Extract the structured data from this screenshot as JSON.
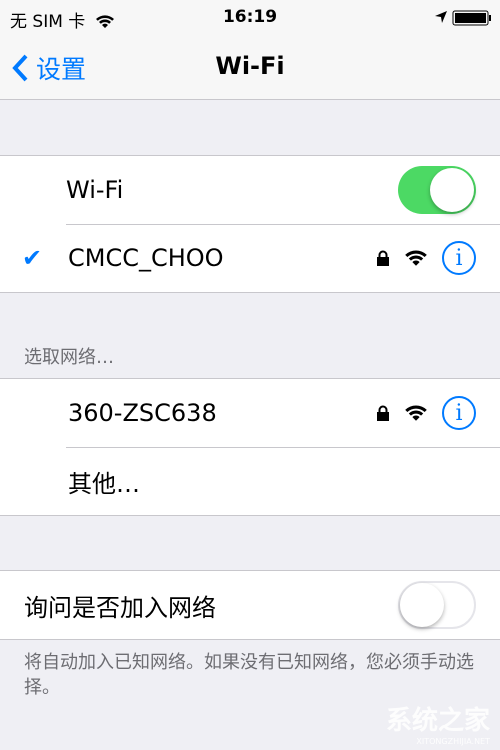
{
  "status_bar": {
    "carrier": "无 SIM 卡",
    "time": "16:19",
    "icons": [
      "wifi-icon",
      "location-arrow-icon",
      "battery-icon"
    ]
  },
  "nav": {
    "back_label": "设置",
    "title": "Wi-Fi"
  },
  "wifi_group": {
    "toggle_label": "Wi-Fi",
    "toggle_on": true,
    "connected_network": "CMCC_CHOO"
  },
  "networks_header": "选取网络…",
  "networks": [
    {
      "name": "360-ZSC638",
      "secured": true
    }
  ],
  "other_label": "其他…",
  "ask_join": {
    "label": "询问是否加入网络",
    "on": false
  },
  "footer": "将自动加入已知网络。如果没有已知网络，您必须手动选择。",
  "watermark": {
    "text": "系统之家",
    "sub": "XITONGZHIJIA.NET"
  },
  "colors": {
    "accent": "#007aff",
    "toggle_on": "#4cd964",
    "background": "#efeff4"
  }
}
